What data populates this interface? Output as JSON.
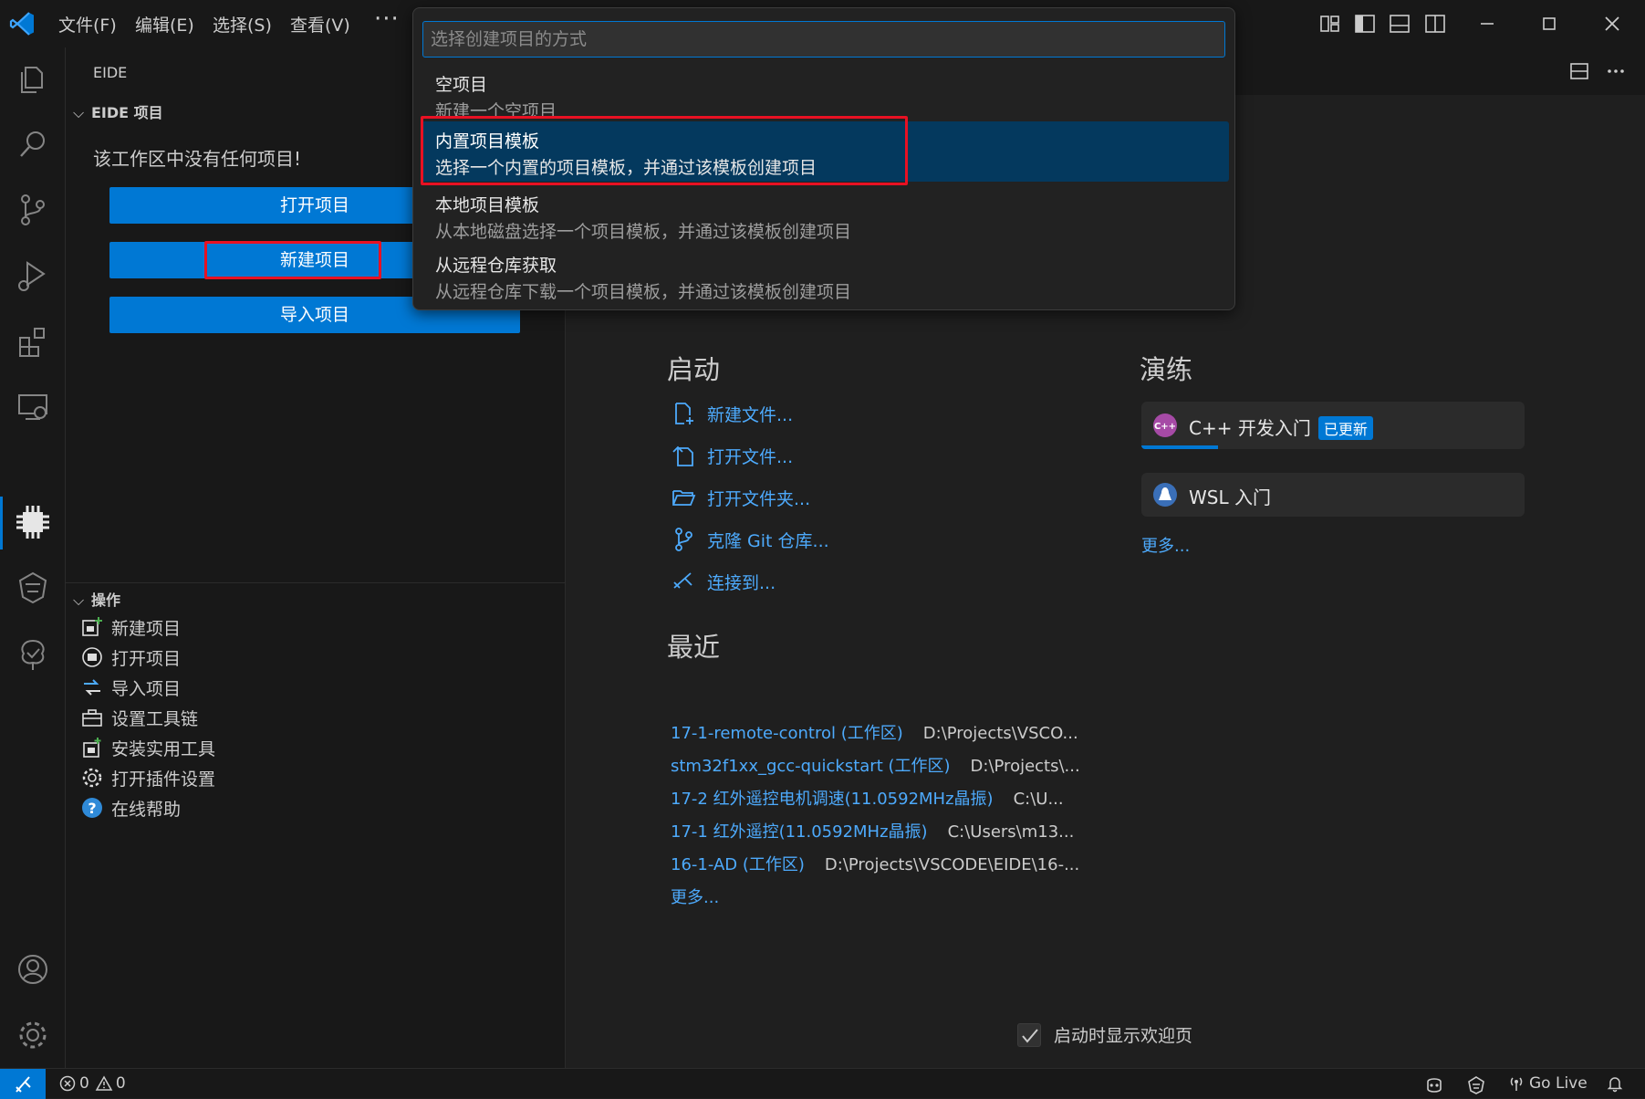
{
  "menu": {
    "file": "文件(F)",
    "edit": "编辑(E)",
    "selection": "选择(S)",
    "view": "查看(V)",
    "more": "···"
  },
  "sidebar": {
    "title": "EIDE",
    "projects_section": "EIDE 项目",
    "empty_message": "该工作区中没有任何项目!",
    "buttons": {
      "open": "打开项目",
      "new": "新建项目",
      "import": "导入项目"
    },
    "operations_section": "操作",
    "operations": [
      {
        "label": "新建项目",
        "icon": "new-project-icon"
      },
      {
        "label": "打开项目",
        "icon": "open-project-icon"
      },
      {
        "label": "导入项目",
        "icon": "import-project-icon"
      },
      {
        "label": "设置工具链",
        "icon": "toolbox-icon"
      },
      {
        "label": "安装实用工具",
        "icon": "install-tools-icon"
      },
      {
        "label": "打开插件设置",
        "icon": "settings-gear-icon"
      },
      {
        "label": "在线帮助",
        "icon": "help-icon"
      }
    ]
  },
  "quickpick": {
    "placeholder": "选择创建项目的方式",
    "items": [
      {
        "label": "空项目",
        "description": "新建一个空项目"
      },
      {
        "label": "内置项目模板",
        "description": "选择一个内置的项目模板，并通过该模板创建项目"
      },
      {
        "label": "本地项目模板",
        "description": "从本地磁盘选择一个项目模板，并通过该模板创建项目"
      },
      {
        "label": "从远程仓库获取",
        "description": "从远程仓库下载一个项目模板，并通过该模板创建项目"
      }
    ],
    "active_index": 1
  },
  "welcome": {
    "start_heading": "启动",
    "start_items": [
      {
        "label": "新建文件...",
        "icon": "new-file-icon"
      },
      {
        "label": "打开文件...",
        "icon": "open-file-icon"
      },
      {
        "label": "打开文件夹...",
        "icon": "open-folder-icon"
      },
      {
        "label": "克隆 Git 仓库...",
        "icon": "git-clone-icon"
      },
      {
        "label": "连接到...",
        "icon": "remote-connect-icon"
      }
    ],
    "recent_heading": "最近",
    "recent_items": [
      {
        "name": "17-1-remote-control (工作区)",
        "path": "D:\\Projects\\VSCO..."
      },
      {
        "name": "stm32f1xx_gcc-quickstart (工作区)",
        "path": "D:\\Projects\\..."
      },
      {
        "name": "17-2 红外遥控电机调速(11.0592MHz晶振)",
        "path": "C:\\U..."
      },
      {
        "name": "17-1 红外遥控(11.0592MHz晶振)",
        "path": "C:\\Users\\m13..."
      },
      {
        "name": "16-1-AD (工作区)",
        "path": "D:\\Projects\\VSCODE\\EIDE\\16-..."
      }
    ],
    "recent_more": "更多...",
    "walkthrough_heading": "演练",
    "walkthroughs": [
      {
        "title": "C++ 开发入门",
        "badge": "已更新",
        "icon": "cpp-icon",
        "progress": 0.2
      },
      {
        "title": "WSL 入门",
        "badge": "",
        "icon": "wsl-icon"
      }
    ],
    "walkthrough_more": "更多...",
    "show_on_startup": "启动时显示欢迎页",
    "show_on_startup_checked": true
  },
  "statusbar": {
    "errors": "0",
    "warnings": "0",
    "go_live": "Go Live"
  },
  "colors": {
    "accent": "#0078d4",
    "highlight_box": "#e81123",
    "link": "#4daafc"
  }
}
